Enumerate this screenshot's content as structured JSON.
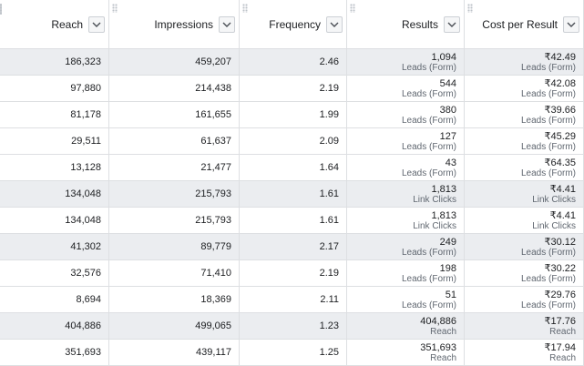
{
  "columns": [
    {
      "label": "Reach",
      "icon": "chevron-down-icon"
    },
    {
      "label": "Impressions",
      "icon": "chevron-down-icon"
    },
    {
      "label": "Frequency",
      "icon": "chevron-down-icon"
    },
    {
      "label": "Results",
      "icon": "chevron-down-icon"
    },
    {
      "label": "Cost per Result",
      "icon": "chevron-down-icon"
    }
  ],
  "colors": {
    "highlight_row": "#ebedf0",
    "border": "#dddfe2"
  },
  "rows": [
    {
      "highlight": true,
      "reach": "186,323",
      "impressions": "459,207",
      "frequency": "2.46",
      "results": "1,094",
      "results_type": "Leads (Form)",
      "cost": "₹42.49",
      "cost_type": "Leads (Form)"
    },
    {
      "highlight": false,
      "reach": "97,880",
      "impressions": "214,438",
      "frequency": "2.19",
      "results": "544",
      "results_type": "Leads (Form)",
      "cost": "₹42.08",
      "cost_type": "Leads (Form)"
    },
    {
      "highlight": false,
      "reach": "81,178",
      "impressions": "161,655",
      "frequency": "1.99",
      "results": "380",
      "results_type": "Leads (Form)",
      "cost": "₹39.66",
      "cost_type": "Leads (Form)"
    },
    {
      "highlight": false,
      "reach": "29,511",
      "impressions": "61,637",
      "frequency": "2.09",
      "results": "127",
      "results_type": "Leads (Form)",
      "cost": "₹45.29",
      "cost_type": "Leads (Form)"
    },
    {
      "highlight": false,
      "reach": "13,128",
      "impressions": "21,477",
      "frequency": "1.64",
      "results": "43",
      "results_type": "Leads (Form)",
      "cost": "₹64.35",
      "cost_type": "Leads (Form)"
    },
    {
      "highlight": true,
      "reach": "134,048",
      "impressions": "215,793",
      "frequency": "1.61",
      "results": "1,813",
      "results_type": "Link Clicks",
      "cost": "₹4.41",
      "cost_type": "Link Clicks"
    },
    {
      "highlight": false,
      "reach": "134,048",
      "impressions": "215,793",
      "frequency": "1.61",
      "results": "1,813",
      "results_type": "Link Clicks",
      "cost": "₹4.41",
      "cost_type": "Link Clicks"
    },
    {
      "highlight": true,
      "reach": "41,302",
      "impressions": "89,779",
      "frequency": "2.17",
      "results": "249",
      "results_type": "Leads (Form)",
      "cost": "₹30.12",
      "cost_type": "Leads (Form)"
    },
    {
      "highlight": false,
      "reach": "32,576",
      "impressions": "71,410",
      "frequency": "2.19",
      "results": "198",
      "results_type": "Leads (Form)",
      "cost": "₹30.22",
      "cost_type": "Leads (Form)"
    },
    {
      "highlight": false,
      "reach": "8,694",
      "impressions": "18,369",
      "frequency": "2.11",
      "results": "51",
      "results_type": "Leads (Form)",
      "cost": "₹29.76",
      "cost_type": "Leads (Form)"
    },
    {
      "highlight": true,
      "reach": "404,886",
      "impressions": "499,065",
      "frequency": "1.23",
      "results": "404,886",
      "results_type": "Reach",
      "cost": "₹17.76",
      "cost_type": "Reach"
    },
    {
      "highlight": false,
      "reach": "351,693",
      "impressions": "439,117",
      "frequency": "1.25",
      "results": "351,693",
      "results_type": "Reach",
      "cost": "₹17.94",
      "cost_type": "Reach"
    }
  ]
}
